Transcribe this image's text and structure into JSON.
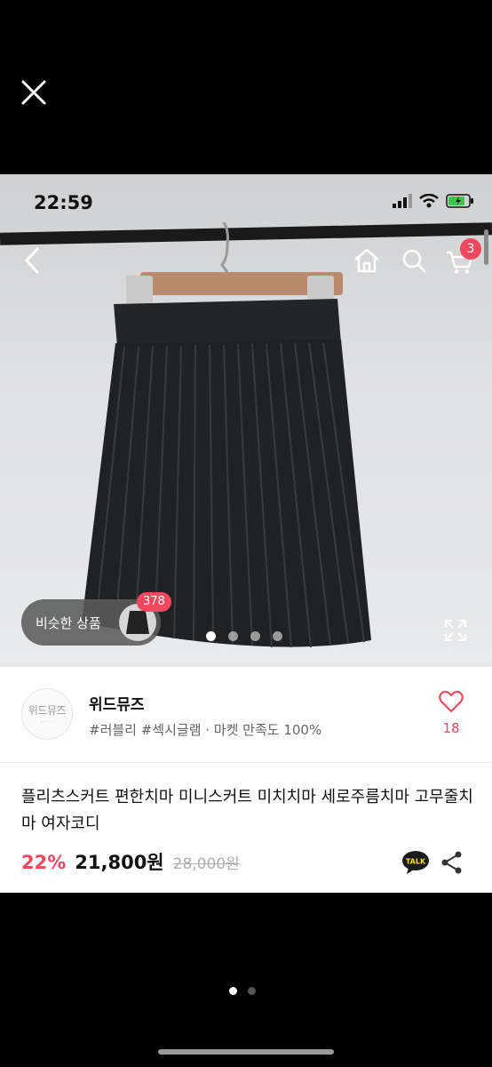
{
  "status_bar": {
    "time": "22:59"
  },
  "header": {
    "cart_count": "3"
  },
  "similar": {
    "label": "비슷한 상품",
    "count": "378"
  },
  "shop": {
    "name": "위드뮤즈",
    "logo_text": "위드뮤즈",
    "tags": "#러블리 #섹시글램 · 마켓 만족도 100%",
    "likes": "18"
  },
  "product": {
    "title": "플리츠스커트 편한치마 미니스커트 미치치마 세로주름치마 고무줄치마 여자코디",
    "discount": "22%",
    "price": "21,800원",
    "original_price": "28,000원"
  },
  "talk": {
    "label": "TALK"
  },
  "colors": {
    "accent": "#f0485f"
  }
}
